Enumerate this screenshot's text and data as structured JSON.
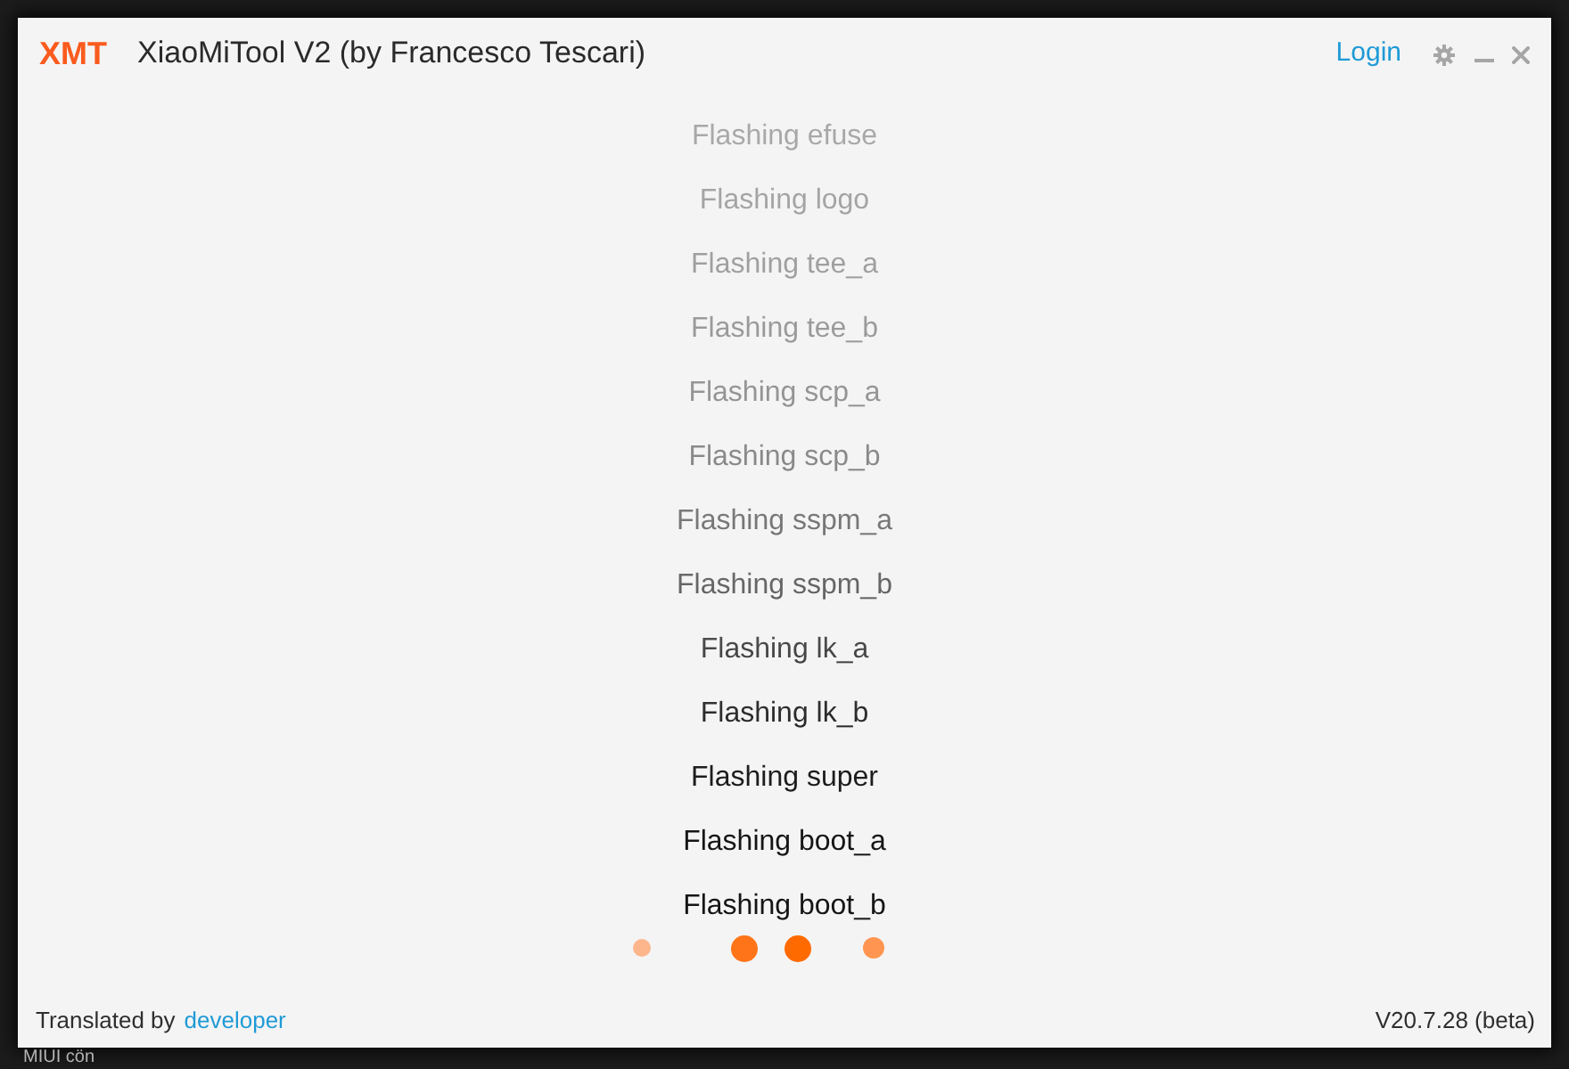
{
  "window": {
    "logo": "XMT",
    "title": "XiaoMiTool V2 (by Francesco Tescari)",
    "login": "Login"
  },
  "log": [
    "Flashing efuse",
    "Flashing logo",
    "Flashing tee_a",
    "Flashing tee_b",
    "Flashing scp_a",
    "Flashing scp_b",
    "Flashing sspm_a",
    "Flashing sspm_b",
    "Flashing lk_a",
    "Flashing lk_b",
    "Flashing super",
    "Flashing boot_a",
    "Flashing boot_b"
  ],
  "footer": {
    "translated_by": "Translated by",
    "translator": "developer",
    "version": "V20.7.28 (beta)"
  },
  "desktop": {
    "background_text": "MIUI cön"
  }
}
